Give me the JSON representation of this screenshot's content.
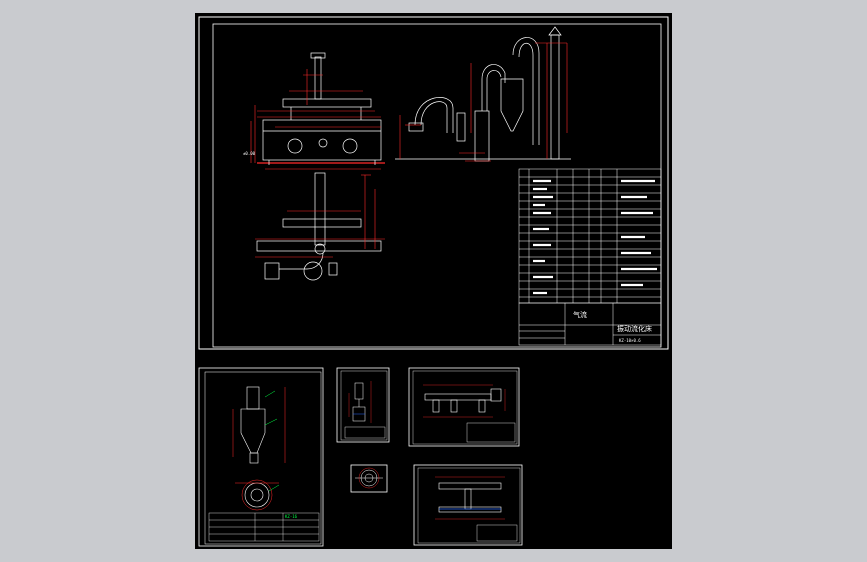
{
  "viewer": {
    "background_color": "#c9cbcf",
    "canvas_color": "#000000"
  },
  "colors": {
    "line": "#ffffff",
    "dimension": "#ff2a2a",
    "annotation": "#00ff44",
    "hidden": "#2a6bff",
    "accent": "#ffff00"
  },
  "main_sheet": {
    "drawing_title": "振动流化床",
    "drawing_code": "KZ-10×0.6",
    "part_label": "气流",
    "ground_label": "±0.00"
  },
  "sub_sheets": [
    {
      "name": "cyclone-sheet",
      "label": "KZ-16"
    },
    {
      "name": "valve-sheet",
      "label": ""
    },
    {
      "name": "frame-sheet",
      "label": ""
    },
    {
      "name": "flange-sheet",
      "label": ""
    },
    {
      "name": "duct-sheet",
      "label": ""
    }
  ]
}
